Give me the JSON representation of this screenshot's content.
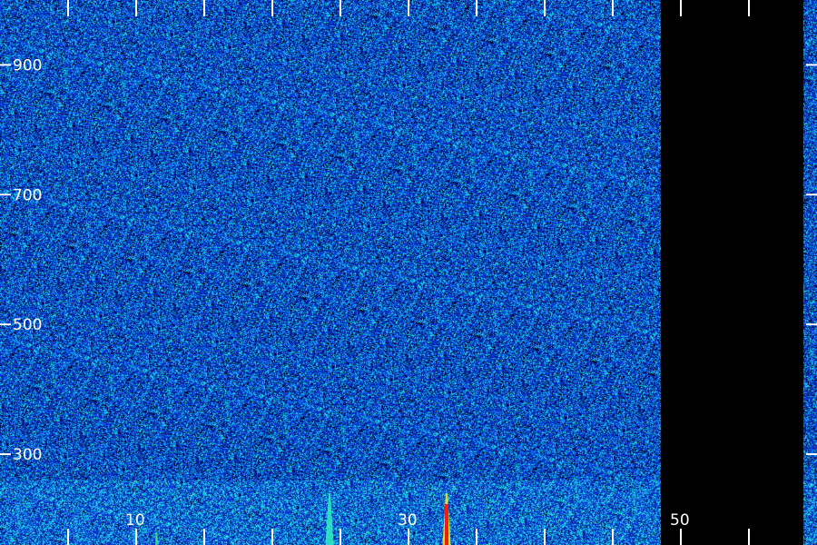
{
  "chart_data": {
    "type": "heatmap",
    "title": "",
    "xlabel": "",
    "ylabel": "",
    "x_ticks": [
      {
        "value": 10,
        "label": "10"
      },
      {
        "value": 30,
        "label": "30"
      },
      {
        "value": 50,
        "label": "50"
      }
    ],
    "y_ticks": [
      {
        "value": 300,
        "label": "300"
      },
      {
        "value": 500,
        "label": "500"
      },
      {
        "value": 700,
        "label": "700"
      },
      {
        "value": 900,
        "label": "900"
      }
    ],
    "xlim": [
      0,
      60
    ],
    "ylim": [
      160,
      1000
    ],
    "minor_x_ticks": [
      5,
      10,
      15,
      20,
      25,
      30,
      35,
      40,
      45,
      50,
      55
    ],
    "data_gap_x": [
      48.5,
      59
    ],
    "bursts": [
      {
        "x": 24.2,
        "y_top": 240,
        "intensity": "high"
      },
      {
        "x": 32.8,
        "y_top": 240,
        "intensity": "very-high"
      },
      {
        "x": 11.5,
        "y_top": 180,
        "intensity": "low"
      }
    ],
    "colormap": [
      "#000000",
      "#0a1a8c",
      "#1e40e6",
      "#20a0f0",
      "#30f0c0",
      "#f0f020",
      "#f02010"
    ],
    "grid": false,
    "legend": "none"
  }
}
